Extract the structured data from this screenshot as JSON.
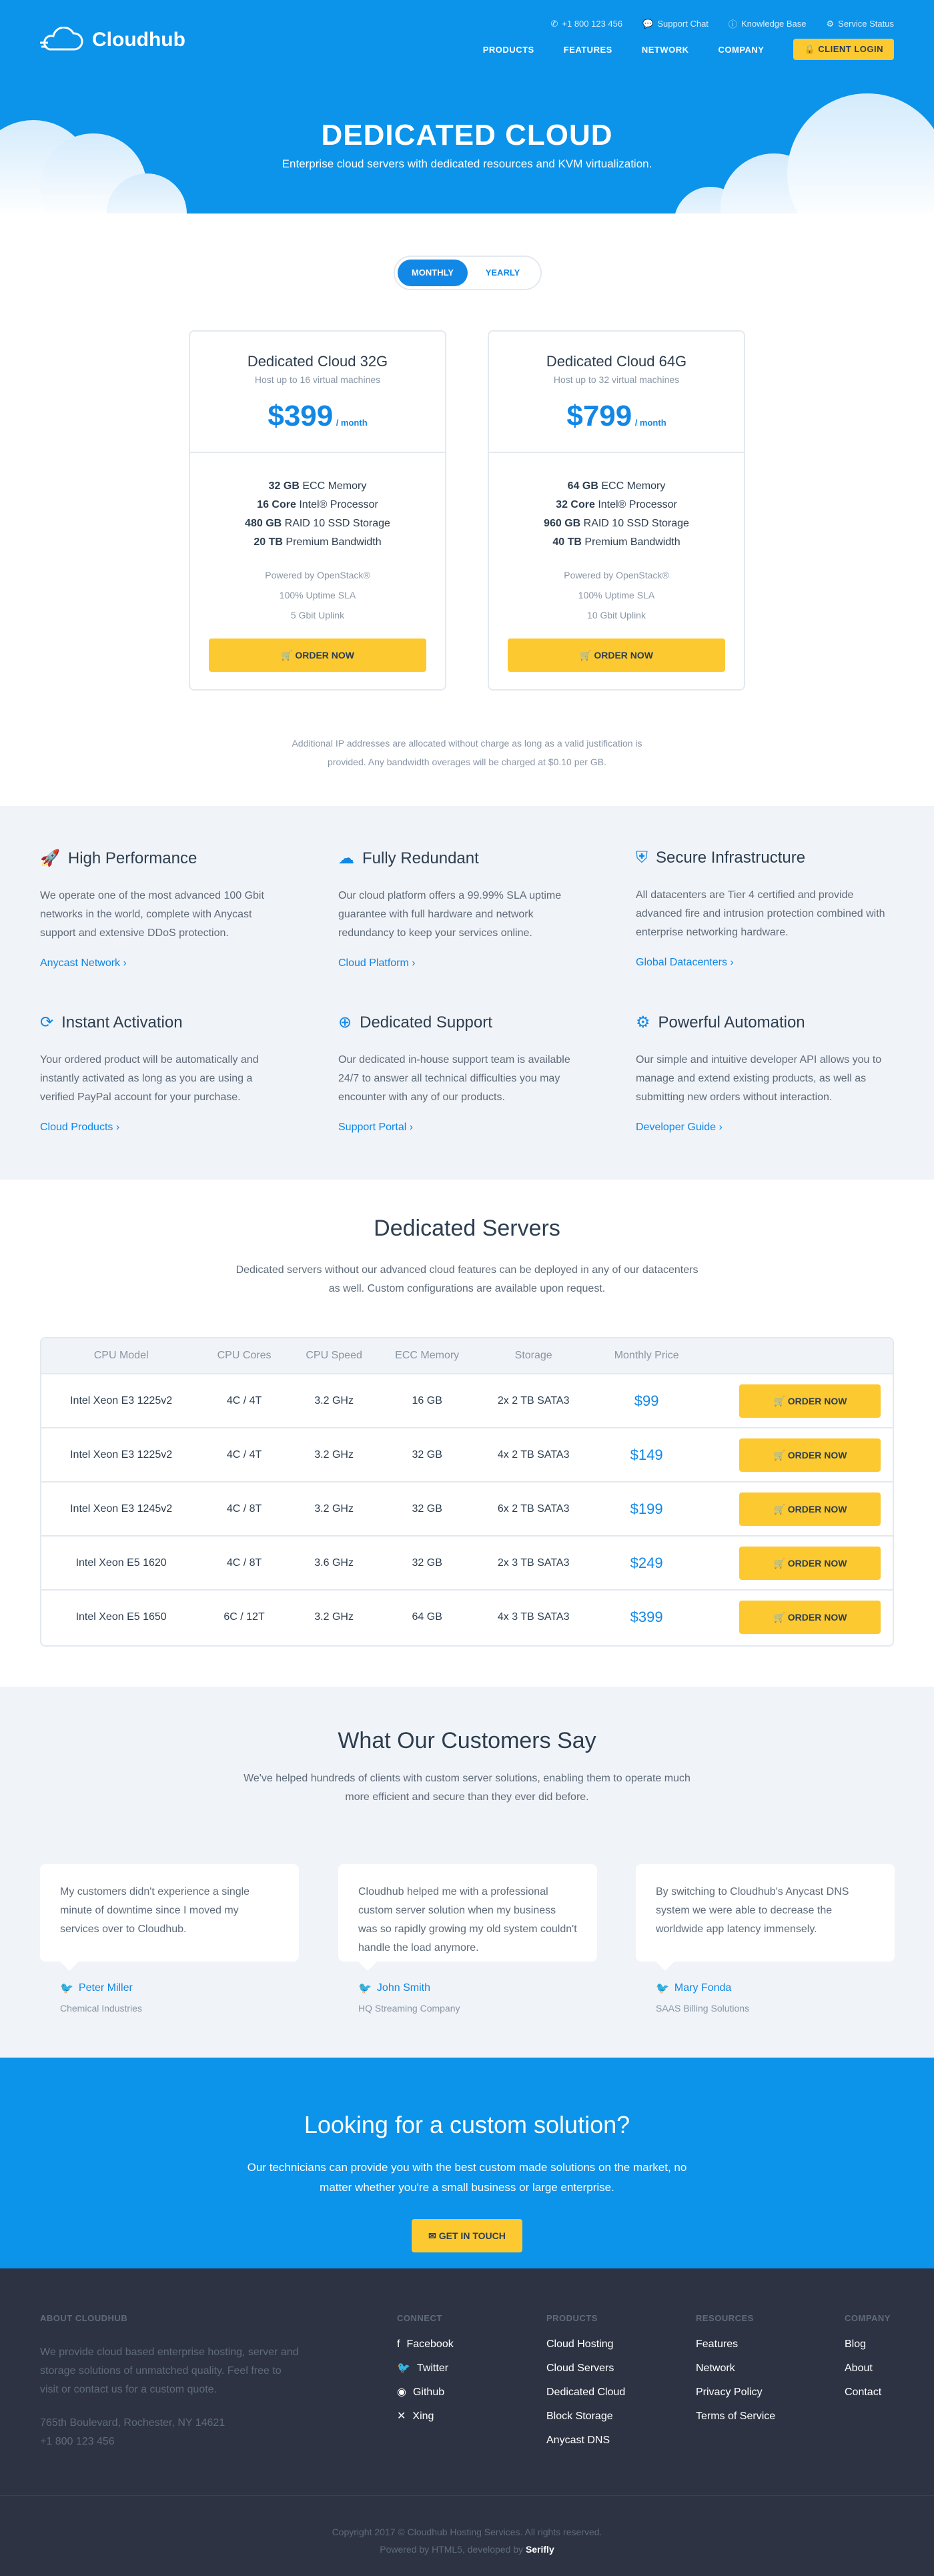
{
  "header": {
    "topbar": [
      {
        "icon": "phone-icon",
        "label": "+1 800 123 456"
      },
      {
        "icon": "chat-icon",
        "label": "Support Chat"
      },
      {
        "icon": "info-icon",
        "label": "Knowledge Base"
      },
      {
        "icon": "status-icon",
        "label": "Service Status"
      }
    ],
    "logo": "Cloudhub",
    "nav": [
      "PRODUCTS",
      "FEATURES",
      "NETWORK",
      "COMPANY"
    ],
    "client_login": "CLIENT LOGIN",
    "title": "DEDICATED CLOUD",
    "subtitle": "Enterprise cloud servers with dedicated resources and KVM virtualization."
  },
  "billing": {
    "monthly": "MONTHLY",
    "yearly": "YEARLY"
  },
  "plans": [
    {
      "name": "Dedicated Cloud 32G",
      "sub": "Host up to 16 virtual machines",
      "price": "$399",
      "per": "/ month",
      "specs": [
        [
          "32 GB",
          " ECC Memory"
        ],
        [
          "16 Core",
          " Intel® Processor"
        ],
        [
          "480 GB",
          " RAID 10 SSD Storage"
        ],
        [
          "20 TB",
          " Premium Bandwidth"
        ]
      ],
      "feats": [
        "Powered by OpenStack®",
        "100% Uptime SLA",
        "5 Gbit Uplink"
      ],
      "order": "ORDER NOW"
    },
    {
      "name": "Dedicated Cloud 64G",
      "sub": "Host up to 32 virtual machines",
      "price": "$799",
      "per": "/ month",
      "specs": [
        [
          "64 GB",
          " ECC Memory"
        ],
        [
          "32 Core",
          " Intel® Processor"
        ],
        [
          "960 GB",
          " RAID 10 SSD Storage"
        ],
        [
          "40 TB",
          " Premium Bandwidth"
        ]
      ],
      "feats": [
        "Powered by OpenStack®",
        "100% Uptime SLA",
        "10 Gbit Uplink"
      ],
      "order": "ORDER NOW"
    }
  ],
  "note": [
    "Additional IP addresses are allocated without charge as long as a valid justification is",
    "provided. Any bandwidth overages will be charged at $0.10 per GB."
  ],
  "features": [
    {
      "icon": "rocket-icon",
      "title": "High Performance",
      "text": "We operate one of the most advanced 100 Gbit networks in the world, complete with Anycast support and extensive DDoS protection.",
      "link": "Anycast Network ›"
    },
    {
      "icon": "cloud-icon",
      "title": "Fully Redundant",
      "text": "Our cloud platform offers a 99.99% SLA uptime guarantee with full hardware and network redundancy to keep your services online.",
      "link": "Cloud Platform ›"
    },
    {
      "icon": "shield-icon",
      "title": "Secure Infrastructure",
      "text": "All datacenters are Tier 4 certified and provide advanced fire and intrusion protection combined with enterprise networking hardware.",
      "link": "Global Datacenters ›"
    },
    {
      "icon": "refresh-icon",
      "title": "Instant Activation",
      "text": "Your ordered product will be automatically and instantly activated as long as you are using a verified PayPal account for your purchase.",
      "link": "Cloud Products ›"
    },
    {
      "icon": "lifebuoy-icon",
      "title": "Dedicated Support",
      "text": "Our dedicated in-house support team is available 24/7 to answer all technical difficulties you may encounter with any of our products.",
      "link": "Support Portal ›"
    },
    {
      "icon": "gear-icon",
      "title": "Powerful Automation",
      "text": "Our simple and intuitive developer API allows you to manage and extend existing products, as well as submitting new orders without interaction.",
      "link": "Developer Guide ›"
    }
  ],
  "servers": {
    "title": "Dedicated Servers",
    "desc": "Dedicated servers without our advanced cloud features can be deployed in any of our datacenters as well. Custom configurations are available upon request.",
    "columns": [
      "CPU Model",
      "CPU Cores",
      "CPU Speed",
      "ECC Memory",
      "Storage",
      "Monthly Price"
    ],
    "rows": [
      [
        "Intel Xeon E3 1225v2",
        "4C / 4T",
        "3.2 GHz",
        "16 GB",
        "2x 2 TB SATA3",
        "$99"
      ],
      [
        "Intel Xeon E3 1225v2",
        "4C / 4T",
        "3.2 GHz",
        "32 GB",
        "4x 2 TB SATA3",
        "$149"
      ],
      [
        "Intel Xeon E3 1245v2",
        "4C / 8T",
        "3.2 GHz",
        "32 GB",
        "6x 2 TB SATA3",
        "$199"
      ],
      [
        "Intel Xeon E5 1620",
        "4C / 8T",
        "3.6 GHz",
        "32 GB",
        "2x 3 TB SATA3",
        "$249"
      ],
      [
        "Intel Xeon E5 1650",
        "6C / 12T",
        "3.2 GHz",
        "64 GB",
        "4x 3 TB SATA3",
        "$399"
      ]
    ],
    "order": "ORDER NOW"
  },
  "testimonials": {
    "title": "What Our Customers Say",
    "desc": "We've helped hundreds of clients with custom server solutions, enabling them to operate much more efficient and secure than they ever did before.",
    "items": [
      {
        "quote": "My customers didn't experience a single minute of downtime since I moved my services over to Cloudhub.",
        "name": "Peter Miller",
        "company": "Chemical Industries"
      },
      {
        "quote": "Cloudhub helped me with a professional custom server solution when my business was so rapidly growing my old system couldn't handle the load anymore.",
        "name": "John Smith",
        "company": "HQ Streaming Company"
      },
      {
        "quote": "By switching to Cloudhub's Anycast DNS system we were able to decrease the worldwide app latency immensely.",
        "name": "Mary Fonda",
        "company": "SAAS Billing Solutions"
      }
    ]
  },
  "cta": {
    "title": "Looking for a custom solution?",
    "text": "Our technicians can provide you with the best custom made solutions on the market, no matter whether you're a small business or large enterprise.",
    "button": "GET IN TOUCH"
  },
  "footer": {
    "about_title": "ABOUT CLOUDHUB",
    "about_text": "We provide cloud based enterprise hosting, server and storage solutions of unmatched quality. Feel free to visit or contact us for a custom quote.",
    "address": "765th Boulevard, Rochester, NY 14621",
    "phone": "+1 800 123 456",
    "connect_title": "CONNECT",
    "connect": [
      "Facebook",
      "Twitter",
      "Github",
      "Xing"
    ],
    "products_title": "PRODUCTS",
    "products": [
      "Cloud Hosting",
      "Cloud Servers",
      "Dedicated Cloud",
      "Block Storage",
      "Anycast DNS"
    ],
    "resources_title": "RESOURCES",
    "resources": [
      "Features",
      "Network",
      "Privacy Policy",
      "Terms of Service"
    ],
    "company_title": "COMPANY",
    "company": [
      "Blog",
      "About",
      "Contact"
    ],
    "copyright": "Copyright 2017 © Cloudhub Hosting Services. All rights reserved.",
    "powered_prefix": "Powered by HTML5, developed by ",
    "powered_brand": "Serifly"
  },
  "colors": {
    "primary": "#0c93ea",
    "accent": "#fdc931",
    "dark": "#2d3343",
    "text": "#5f6b7a"
  }
}
